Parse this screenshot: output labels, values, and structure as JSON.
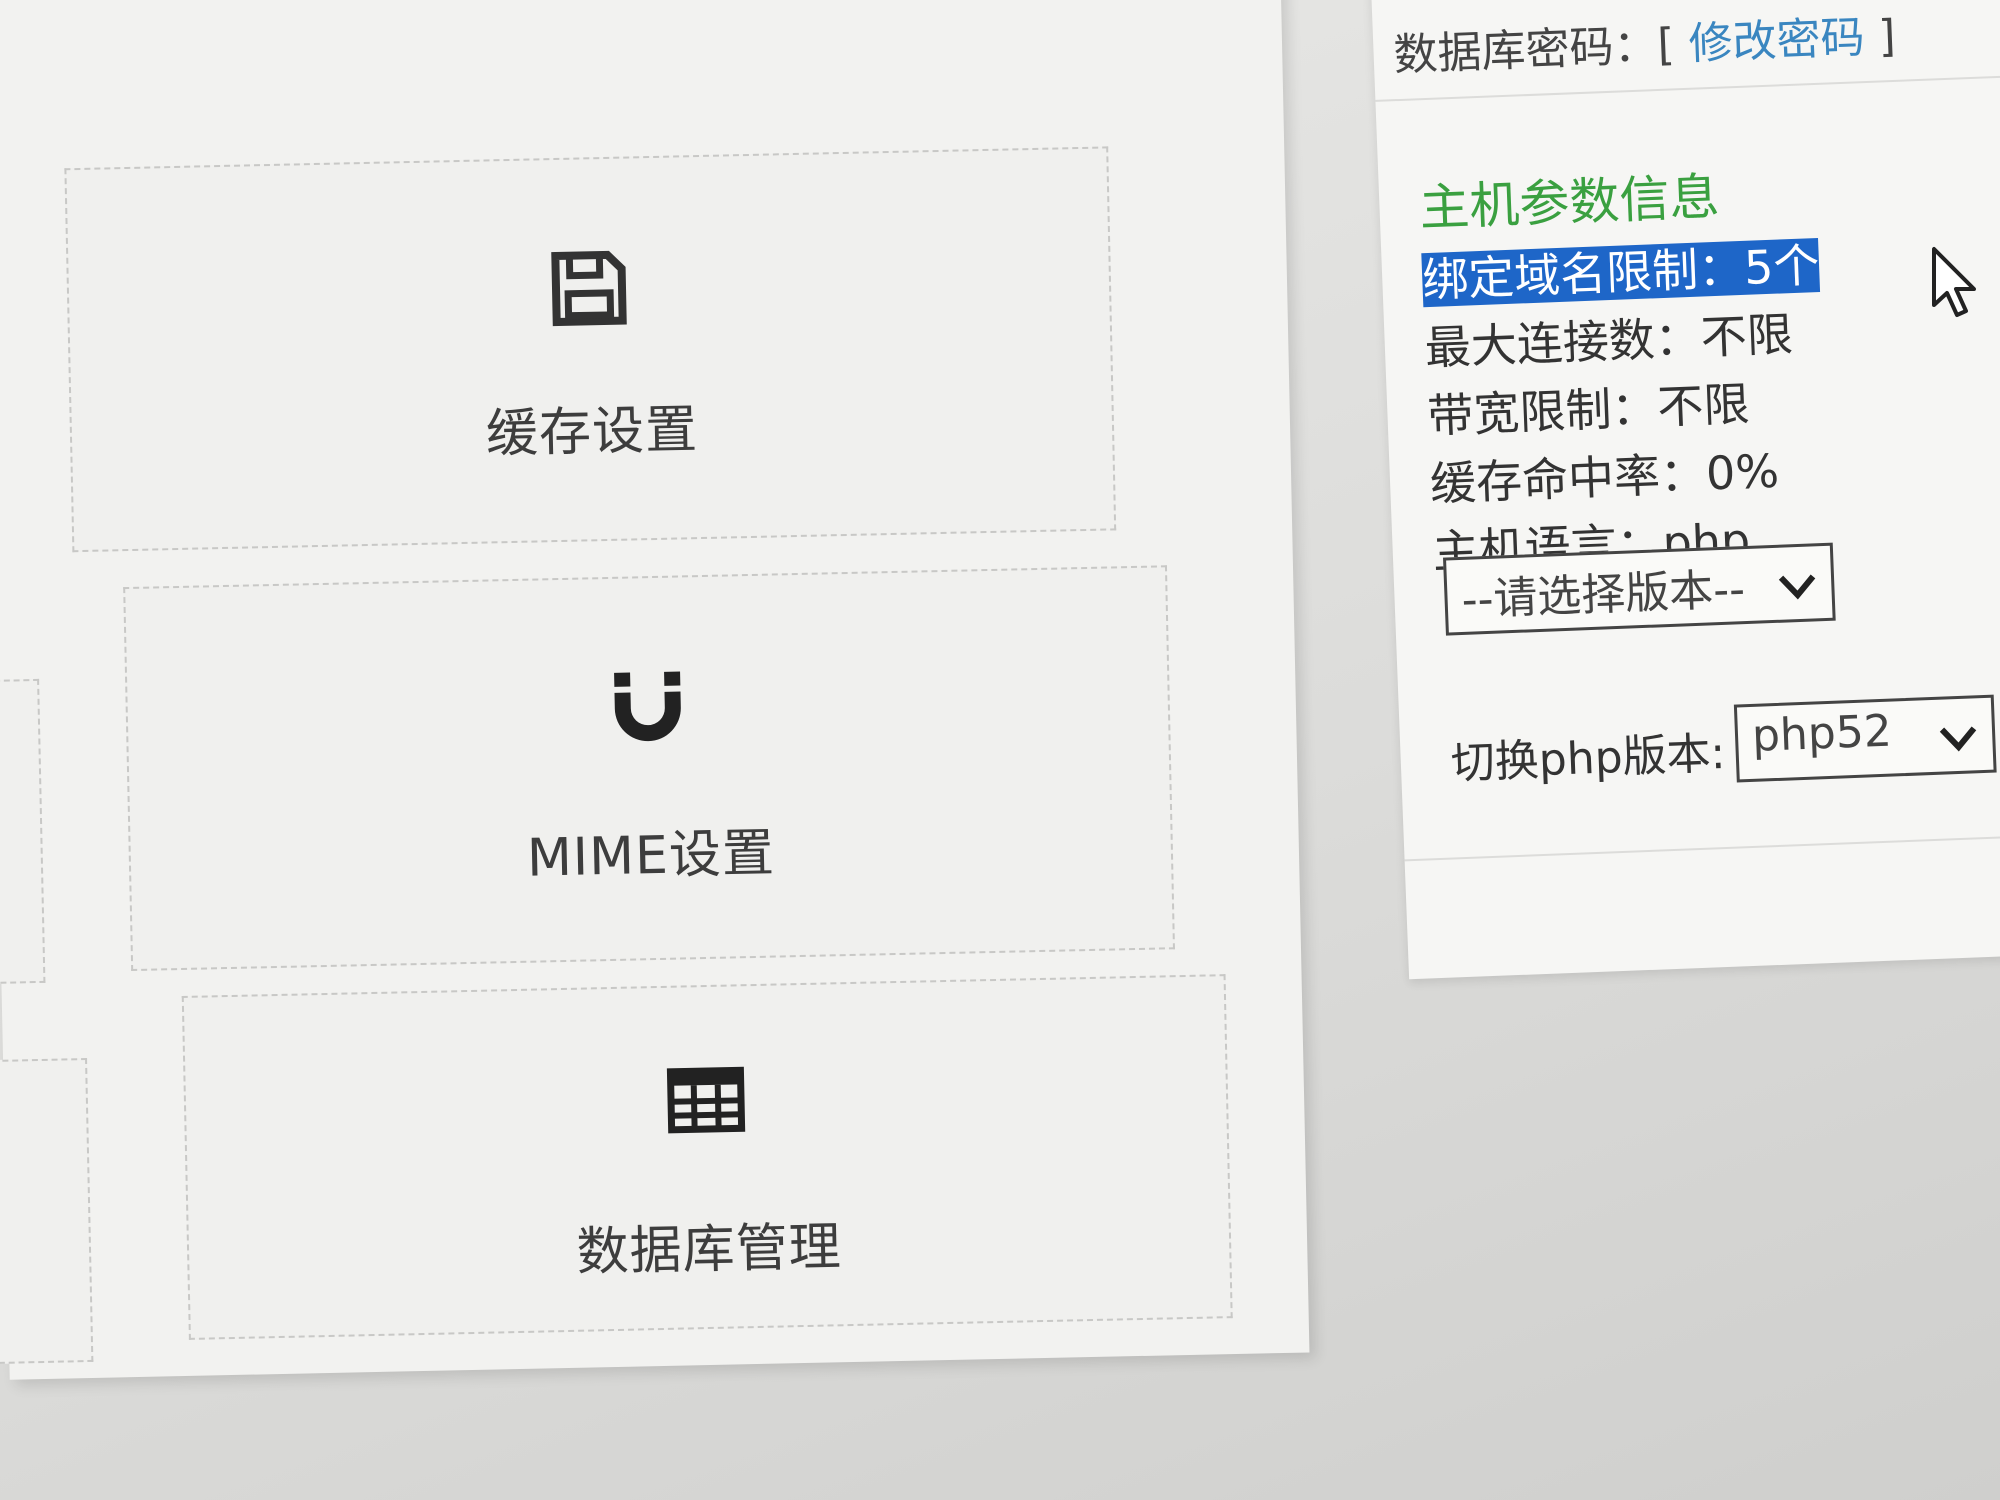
{
  "cards": {
    "cache": {
      "label": "缓存设置",
      "icon": "save-icon"
    },
    "mime": {
      "label": "MIME设置",
      "icon": "magnet-icon"
    },
    "database": {
      "label": "数据库管理",
      "icon": "table-icon"
    }
  },
  "database": {
    "password_label": "数据库密码：[",
    "change_password_link": "修改密码",
    "password_close": "]"
  },
  "host_info": {
    "title": "主机参数信息",
    "rows": [
      "绑定域名限制：5个",
      "最大连接数：不限",
      "带宽限制：不限",
      "缓存命中率：0%",
      "主机语言：php"
    ],
    "version_select_placeholder": "--请选择版本--"
  },
  "php_switch": {
    "label": "切换php版本:",
    "selected": "php52"
  },
  "colors": {
    "title_green": "#3aa040",
    "link_blue": "#3a86c0",
    "selection_blue": "#1e66c8"
  }
}
